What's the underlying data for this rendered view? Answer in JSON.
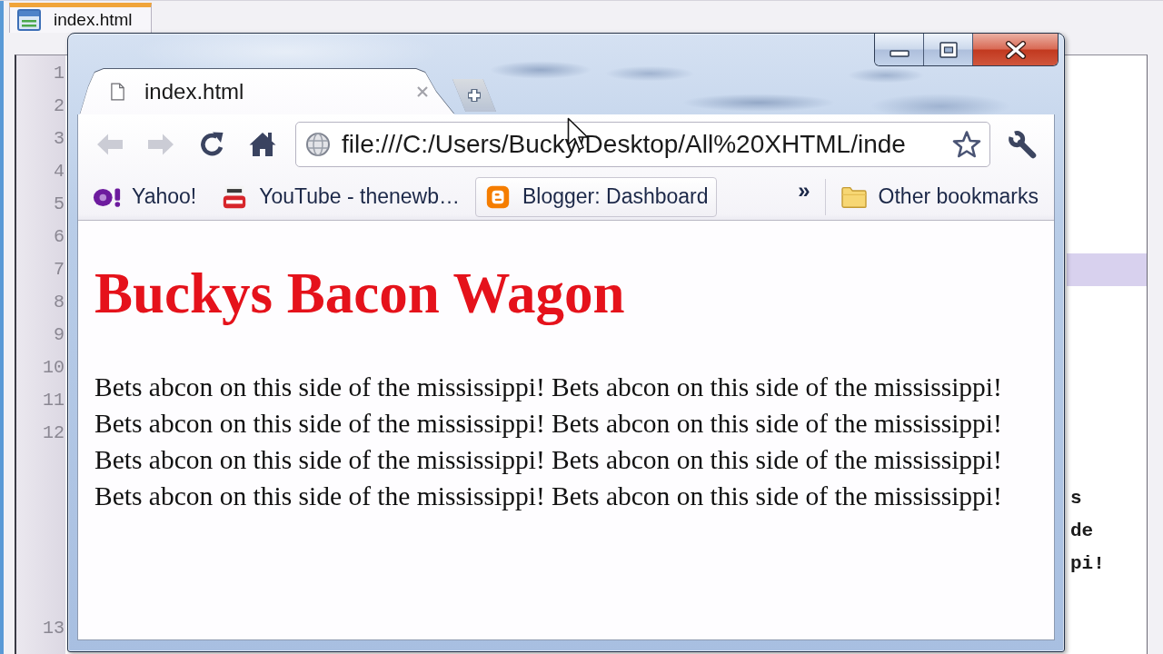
{
  "editor": {
    "tab": {
      "label": "index.html",
      "selected": true
    },
    "lines": [
      {
        "number": "1",
        "current": false
      },
      {
        "number": "2",
        "current": false
      },
      {
        "number": "3",
        "current": false
      },
      {
        "number": "4",
        "current": false
      },
      {
        "number": "5",
        "current": false
      },
      {
        "number": "6",
        "current": false
      },
      {
        "number": "7",
        "current": true
      },
      {
        "number": "8",
        "current": false
      },
      {
        "number": "9",
        "current": false
      },
      {
        "number": "10",
        "current": false
      },
      {
        "number": "11",
        "current": false
      },
      {
        "number": "12",
        "current": false
      },
      {
        "number": "13",
        "current": false
      }
    ],
    "code_fragments": [
      "s",
      "de",
      "pi!"
    ]
  },
  "browser": {
    "tabs": [
      {
        "title": "index.html",
        "selected": true
      }
    ],
    "nav_buttons": [
      {
        "kind": "back",
        "disabled": true
      },
      {
        "kind": "forward",
        "disabled": true
      },
      {
        "kind": "reload",
        "disabled": false
      },
      {
        "kind": "home",
        "disabled": false
      }
    ],
    "address_bar": {
      "value": "file:///C:/Users/Bucky/Desktop/All%20XHTML/inde",
      "starred": false
    },
    "bookmarks": [
      {
        "kind": "yahoo",
        "label": "Yahoo!",
        "hovered": false
      },
      {
        "kind": "youtube",
        "label": "YouTube - thenewb…",
        "hovered": false
      },
      {
        "kind": "blogger",
        "label": "Blogger: Dashboard",
        "hovered": true
      }
    ],
    "bookmarks_overflow": "»",
    "other_bookmarks": {
      "label": "Other bookmarks"
    },
    "page": {
      "heading": "Buckys Bacon Wagon",
      "paragraph": "Bets abcon on this side of the mississippi! Bets abcon on this side of the mississippi! Bets abcon on this side of the mississippi! Bets abcon on this side of the mississippi! Bets abcon on this side of the mississippi! Bets abcon on this side of the mississippi! Bets abcon on this side of the mississippi! Bets abcon on this side of the mississippi!"
    }
  }
}
